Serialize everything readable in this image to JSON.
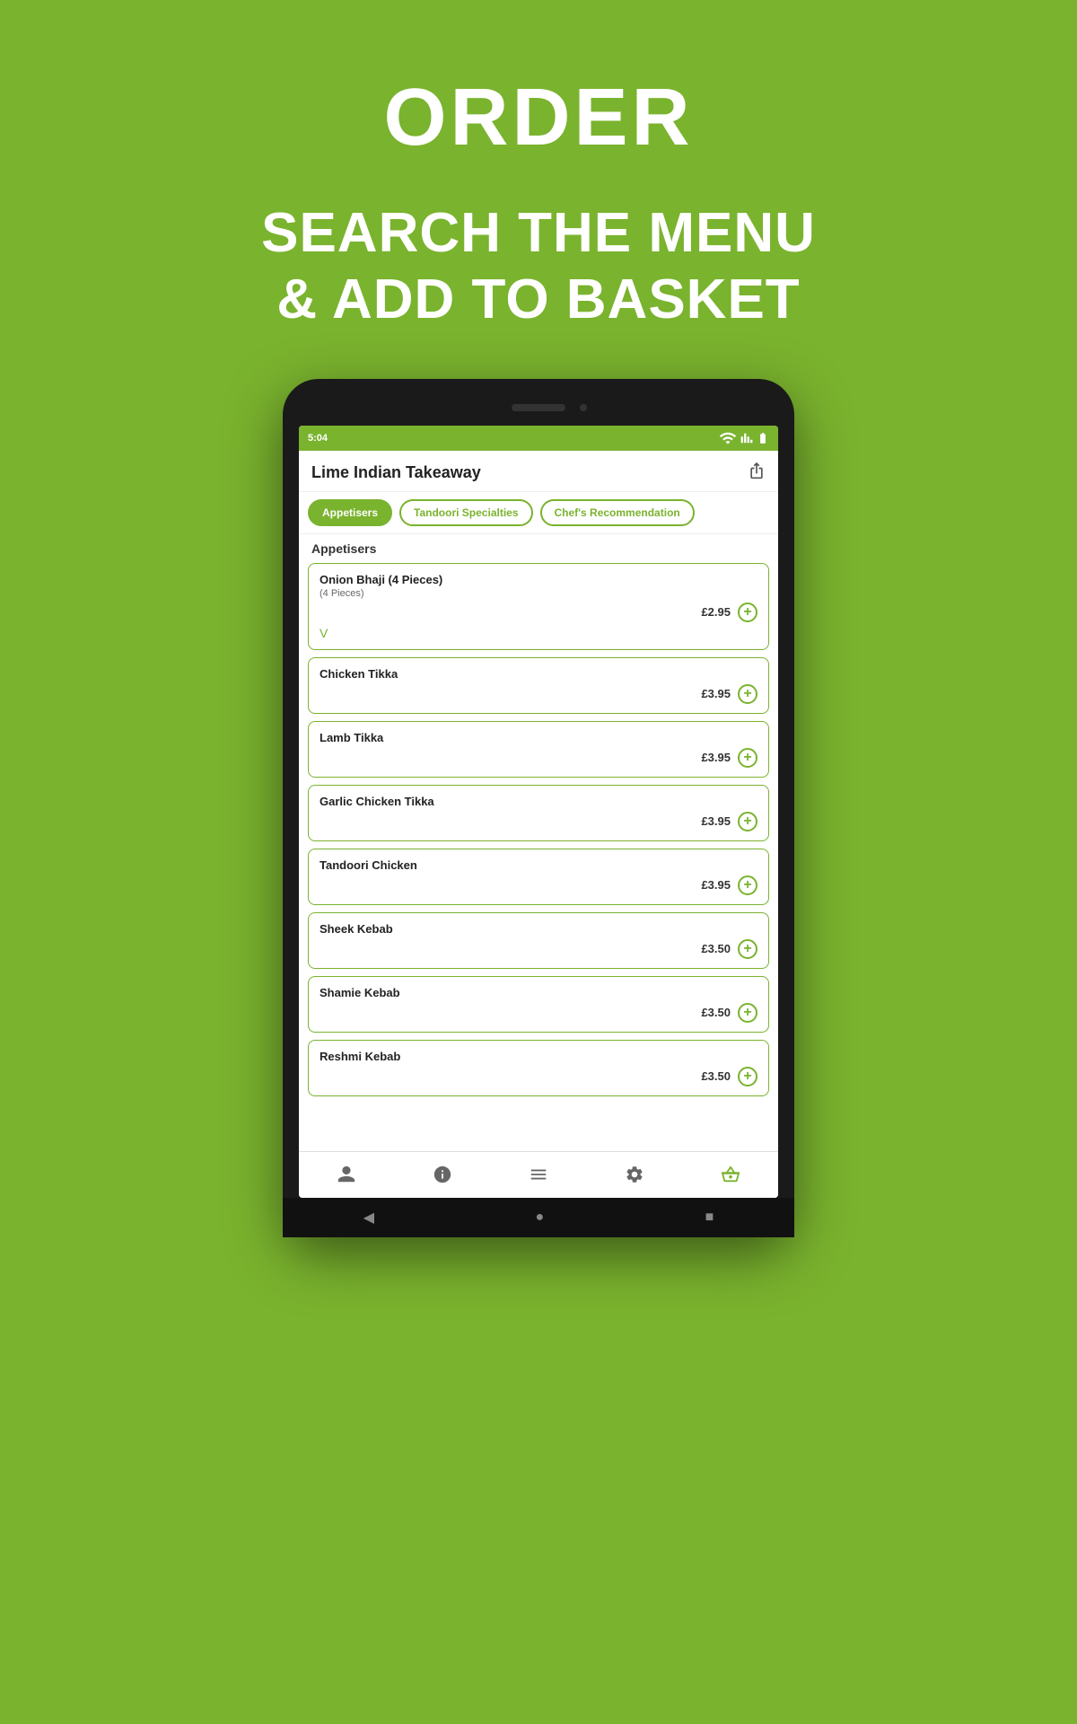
{
  "background_color": "#7ab32e",
  "header": {
    "title": "ORDER",
    "subtitle_line1": "SEARCH THE MENU",
    "subtitle_line2": "& ADD TO BASKET"
  },
  "status_bar": {
    "time": "5:04",
    "icons": [
      "battery",
      "signal",
      "wifi"
    ]
  },
  "app": {
    "title": "Lime Indian Takeaway",
    "share_label": "share"
  },
  "tabs": [
    {
      "label": "Appetisers",
      "active": true
    },
    {
      "label": "Tandoori Specialties",
      "active": false
    },
    {
      "label": "Chef's Recommendation",
      "active": false
    }
  ],
  "section_heading": "Appetisers",
  "menu_items": [
    {
      "name": "Onion Bhaji (4 Pieces)",
      "sub": "(4 Pieces)",
      "price": "£2.95",
      "veg": true
    },
    {
      "name": "Chicken Tikka",
      "sub": "",
      "price": "£3.95",
      "veg": false
    },
    {
      "name": "Lamb Tikka",
      "sub": "",
      "price": "£3.95",
      "veg": false
    },
    {
      "name": "Garlic Chicken Tikka",
      "sub": "",
      "price": "£3.95",
      "veg": false
    },
    {
      "name": "Tandoori Chicken",
      "sub": "",
      "price": "£3.95",
      "veg": false
    },
    {
      "name": "Sheek Kebab",
      "sub": "",
      "price": "£3.50",
      "veg": false
    },
    {
      "name": "Shamie Kebab",
      "sub": "",
      "price": "£3.50",
      "veg": false
    },
    {
      "name": "Reshmi Kebab",
      "sub": "",
      "price": "£3.50",
      "veg": false
    }
  ],
  "bottom_nav": [
    {
      "icon": "person",
      "label": "profile",
      "active": false
    },
    {
      "icon": "info",
      "label": "info",
      "active": false
    },
    {
      "icon": "menu",
      "label": "menu",
      "active": false
    },
    {
      "icon": "settings",
      "label": "settings",
      "active": false
    },
    {
      "icon": "basket",
      "label": "basket",
      "active": true
    }
  ],
  "android_nav": {
    "back_label": "◀",
    "home_label": "●",
    "recent_label": "■"
  }
}
